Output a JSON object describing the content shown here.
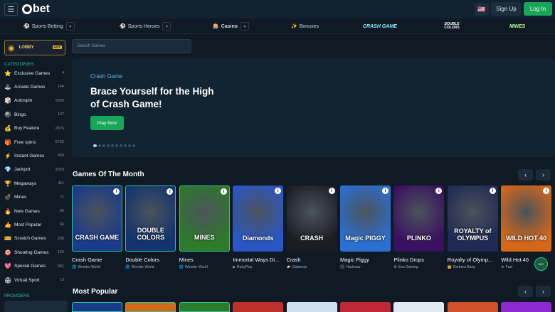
{
  "header": {
    "brand": "bet",
    "signup": "Sign Up",
    "login": "Log In",
    "lang_flag": "🇺🇸"
  },
  "nav": [
    {
      "label": "Sports Betting",
      "icon": "⚽"
    },
    {
      "label": "Sports Heroes",
      "icon": "⚽"
    },
    {
      "label": "Casino",
      "icon": "🎰"
    },
    {
      "label": "Bonuses",
      "icon": "✨"
    }
  ],
  "nav_brands": [
    "CRASH GAME",
    "DOUBLE COLORS",
    "MINES"
  ],
  "sidebar": {
    "lobby": "LOBBY",
    "hot": "HOT",
    "categories_title": "CATEGORIES",
    "categories": [
      {
        "label": "Exclusive Games",
        "count": "4",
        "icon": "⭐"
      },
      {
        "label": "Arcade Games",
        "count": "144",
        "icon": "🕹"
      },
      {
        "label": "Autospin",
        "count": "9336",
        "icon": "🎲"
      },
      {
        "label": "Bingo",
        "count": "107",
        "icon": "🎱"
      },
      {
        "label": "Buy Feature",
        "count": "2876",
        "icon": "💰"
      },
      {
        "label": "Free spins",
        "count": "6725",
        "icon": "🎁"
      },
      {
        "label": "Instant Games",
        "count": "409",
        "icon": "⚡"
      },
      {
        "label": "Jackpot",
        "count": "2029",
        "icon": "💎"
      },
      {
        "label": "Megaways",
        "count": "411",
        "icon": "🏆"
      },
      {
        "label": "Mines",
        "count": "71",
        "icon": "💣"
      },
      {
        "label": "New Games",
        "count": "66",
        "icon": "🔥"
      },
      {
        "label": "Most Popular",
        "count": "66",
        "icon": "👍"
      },
      {
        "label": "Scratch Games",
        "count": "200",
        "icon": "🎫"
      },
      {
        "label": "Shooting Games",
        "count": "124",
        "icon": "🎯"
      },
      {
        "label": "Special Games",
        "count": "901",
        "icon": "💖"
      },
      {
        "label": "Virtual Sport",
        "count": "13",
        "icon": "🏟"
      }
    ],
    "providers_title": "PROVIDERS"
  },
  "search": {
    "placeholder": "Search Games"
  },
  "hero": {
    "subtitle": "Crash Game",
    "title": "Brace Yourself for the High of Crash Game!",
    "cta": "Play Now"
  },
  "sections": {
    "games_of_month": "Games Of The Month",
    "most_popular": "Most Popular"
  },
  "games": [
    {
      "name": "Crash Game",
      "provider": "Wonder World",
      "art": "CRASH GAME",
      "bg": "#1a3a8a",
      "icon": "🌐"
    },
    {
      "name": "Double Colors",
      "provider": "Wonder World",
      "art": "DOUBLE COLORS",
      "bg": "#13346e",
      "icon": "🌐"
    },
    {
      "name": "Mines",
      "provider": "Wonder World",
      "art": "MINES",
      "bg": "#2c7a2a",
      "icon": "🌐"
    },
    {
      "name": "Immortal Ways Di...",
      "provider": "RubyPlay",
      "art": "Diamonds",
      "bg": "#2a56c4",
      "icon": "▶"
    },
    {
      "name": "Crash",
      "provider": "Galaxsys",
      "art": "CRASH",
      "bg": "#1c1c24",
      "icon": "🪐"
    },
    {
      "name": "Magic Piggy",
      "provider": "Hacksaw",
      "art": "Magic PIGGY",
      "bg": "#2b6fd0",
      "icon": "⬛"
    },
    {
      "name": "Plinko Drops",
      "provider": "Esa Gaming",
      "art": "PLINKO",
      "bg": "#3a1060",
      "icon": "⚙"
    },
    {
      "name": "Royalty of Olymp...",
      "provider": "Barbara Bang",
      "art": "ROYALTY of OLYMPUS",
      "bg": "#1f2a55",
      "icon": "👑"
    },
    {
      "name": "Wild Hot 40",
      "provider": "Fazi",
      "art": "WILD HOT 40",
      "bg": "#d6671a",
      "icon": "★"
    }
  ],
  "chat": {
    "label": "24/7"
  }
}
